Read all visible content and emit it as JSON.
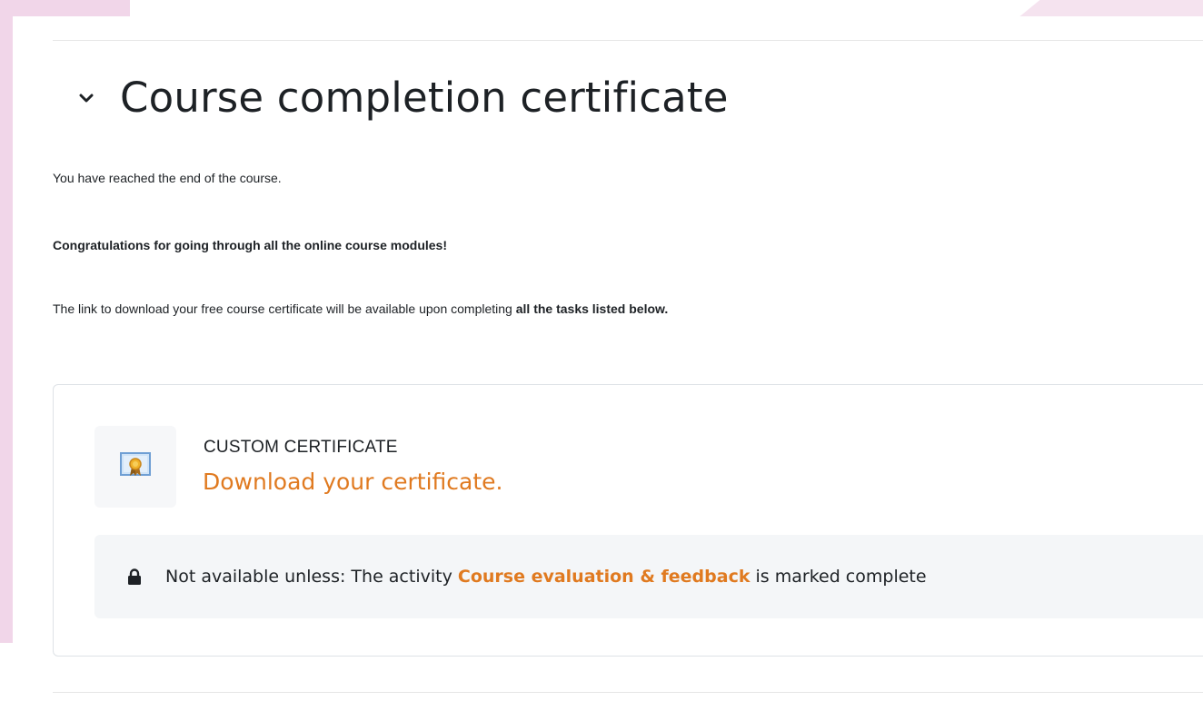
{
  "section": {
    "title": "Course completion certificate",
    "collapse_icon": "chevron-down-icon"
  },
  "intro": {
    "line1": "You have reached the end of the course.",
    "line2": "Congratulations for going through all the online course modules!",
    "line3_prefix": "The link to download your free course certificate will be available upon completing ",
    "line3_bold": "all the tasks listed below."
  },
  "activity": {
    "type_label": "CUSTOM CERTIFICATE",
    "link_label": "Download your certificate.",
    "icon": "certificate-icon",
    "restriction": {
      "icon": "lock-icon",
      "prefix": "Not available unless: The activity ",
      "activity_link": "Course evaluation & feedback",
      "suffix": " is marked complete"
    }
  },
  "colors": {
    "accent": "#e07a20",
    "text": "#1d2125",
    "frame": "#f1d6e9"
  }
}
